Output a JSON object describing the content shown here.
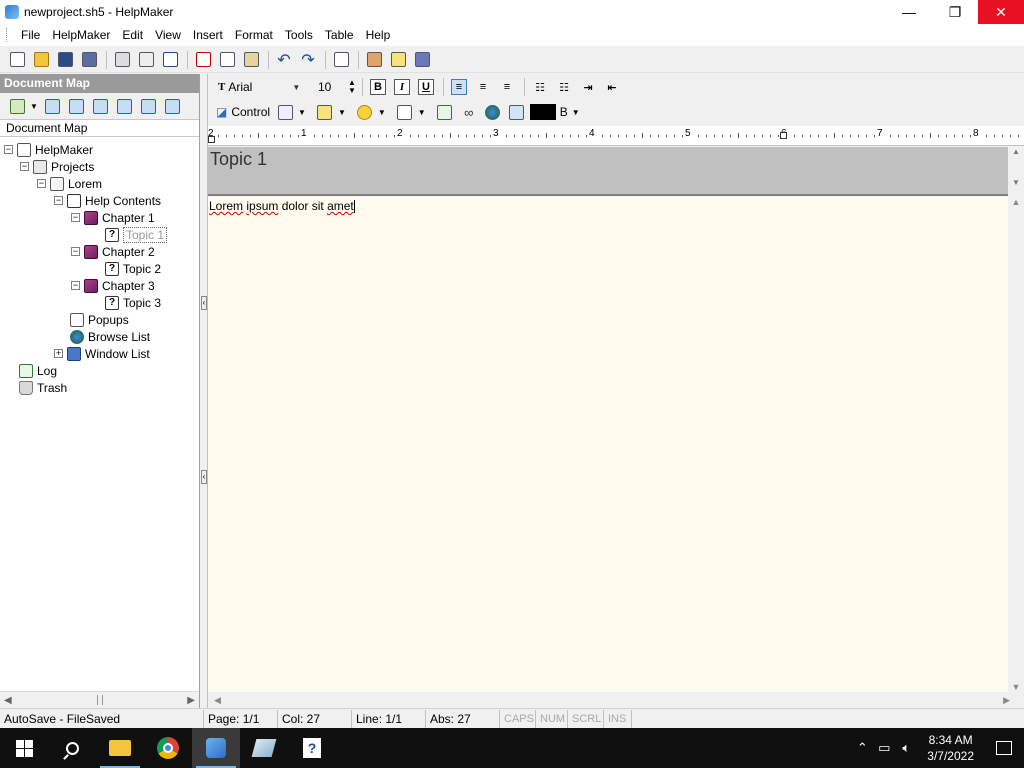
{
  "window": {
    "title": "newproject.sh5 - HelpMaker",
    "minimize": "—",
    "restore": "❐",
    "close": "✕"
  },
  "menu": [
    "File",
    "HelpMaker",
    "Edit",
    "View",
    "Insert",
    "Format",
    "Tools",
    "Table",
    "Help"
  ],
  "docmap": {
    "header": "Document Map",
    "label": "Document Map",
    "tree": {
      "root": "HelpMaker",
      "projects": "Projects",
      "project": "Lorem",
      "help_contents": "Help Contents",
      "chapter1": "Chapter 1",
      "topic1": "Topic 1",
      "chapter2": "Chapter 2",
      "topic2": "Topic 2",
      "chapter3": "Chapter 3",
      "topic3": "Topic 3",
      "popups": "Popups",
      "browse_list": "Browse List",
      "window_list": "Window List",
      "log": "Log",
      "trash": "Trash"
    }
  },
  "format": {
    "font": "Arial",
    "size": "10",
    "bold": "B",
    "italic": "I",
    "underline": "U",
    "control": "Control",
    "color_label": "B"
  },
  "ruler": [
    "2",
    "1",
    "2",
    "3",
    "4",
    "5",
    "6",
    "7",
    "8"
  ],
  "topic": {
    "title": "Topic 1",
    "body_words": [
      "Lorem",
      " ",
      "ipsum",
      " dolor sit ",
      "amet"
    ]
  },
  "status": {
    "autosave": "AutoSave - FileSaved",
    "page": "Page: 1/1",
    "col": "Col: 27",
    "line": "Line: 1/1",
    "abs": "Abs: 27",
    "caps": "CAPS",
    "num": "NUM",
    "scrl": "SCRL",
    "ins": "INS"
  },
  "taskbar": {
    "time": "8:34 AM",
    "date": "3/7/2022"
  }
}
